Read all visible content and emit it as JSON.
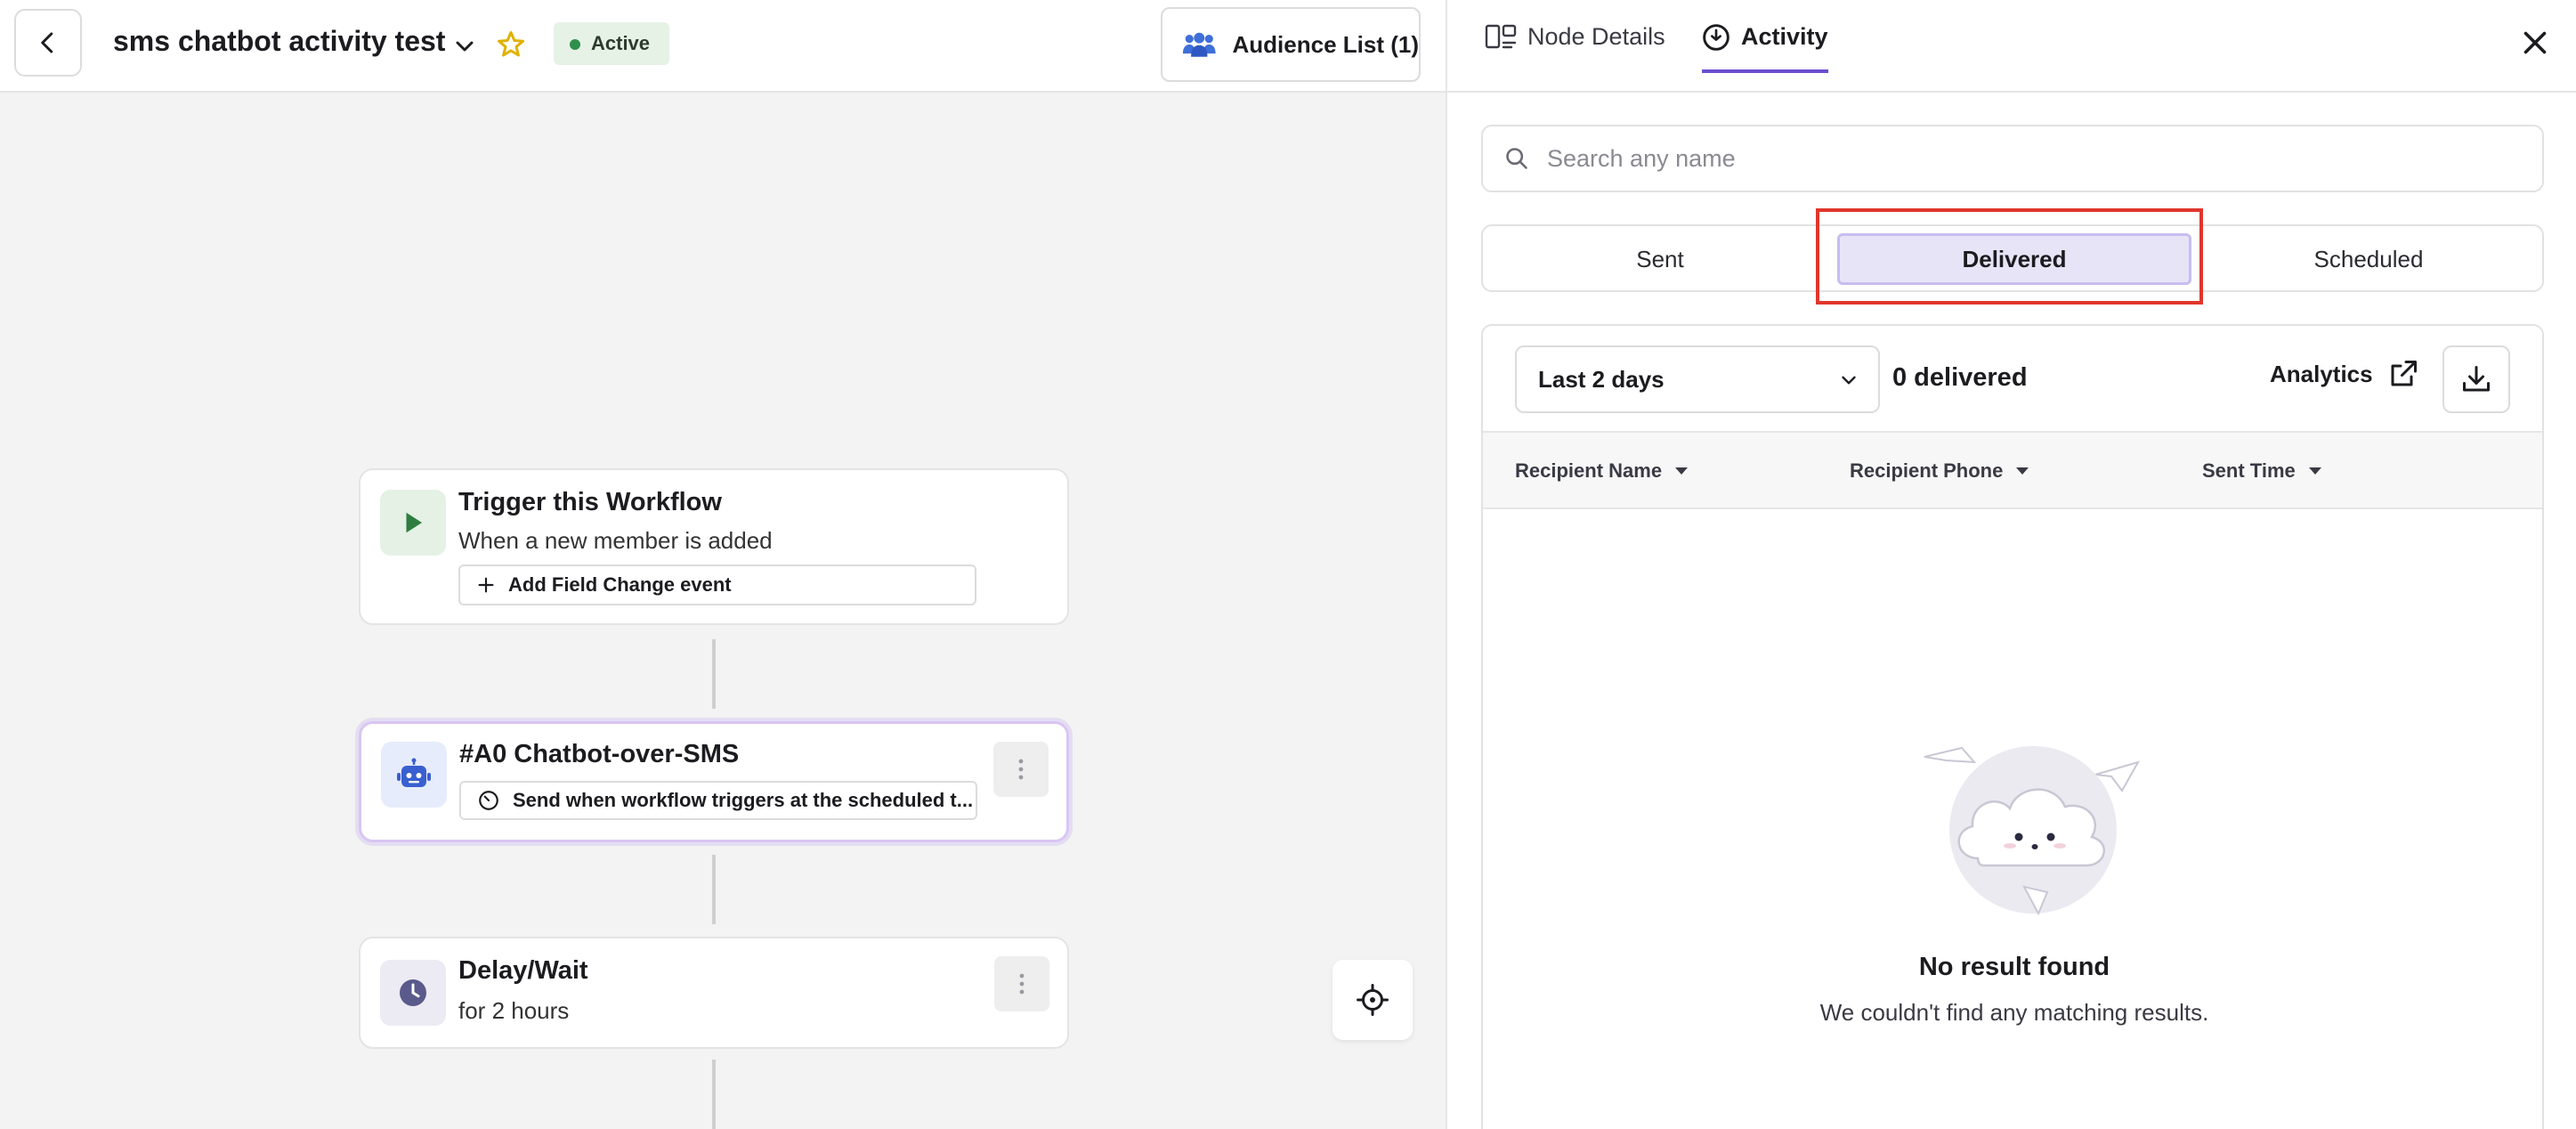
{
  "header": {
    "workflow_title": "sms chatbot activity test",
    "status": "Active",
    "audience_button": "Audience List (1)"
  },
  "canvas": {
    "nodes": [
      {
        "title": "Trigger this Workflow",
        "subtitle": "When a new member is added",
        "chip": "Add Field Change event",
        "icon": "play-icon"
      },
      {
        "title": "#A0 Chatbot-over-SMS",
        "chip": "Send when workflow triggers at the scheduled t...",
        "icon": "robot-icon"
      },
      {
        "title": "Delay/Wait",
        "subtitle": "for 2 hours",
        "icon": "clock-icon"
      }
    ]
  },
  "panel": {
    "tabs": [
      {
        "label": "Node Details",
        "active": false
      },
      {
        "label": "Activity",
        "active": true
      }
    ],
    "search_placeholder": "Search any name",
    "segments": [
      "Sent",
      "Delivered",
      "Scheduled"
    ],
    "active_segment": "Delivered",
    "range_select": "Last 2 days",
    "count_label": "0 delivered",
    "analytics_label": "Analytics",
    "columns": [
      "Recipient Name",
      "Recipient Phone",
      "Sent Time"
    ],
    "empty_title": "No result found",
    "empty_subtitle": "We couldn't find any matching results."
  },
  "colors": {
    "accent": "#6c4fd0",
    "active_segment_bg": "#e8e4f7",
    "status_bg": "#e6f2e6",
    "highlight": "#e0362c"
  }
}
